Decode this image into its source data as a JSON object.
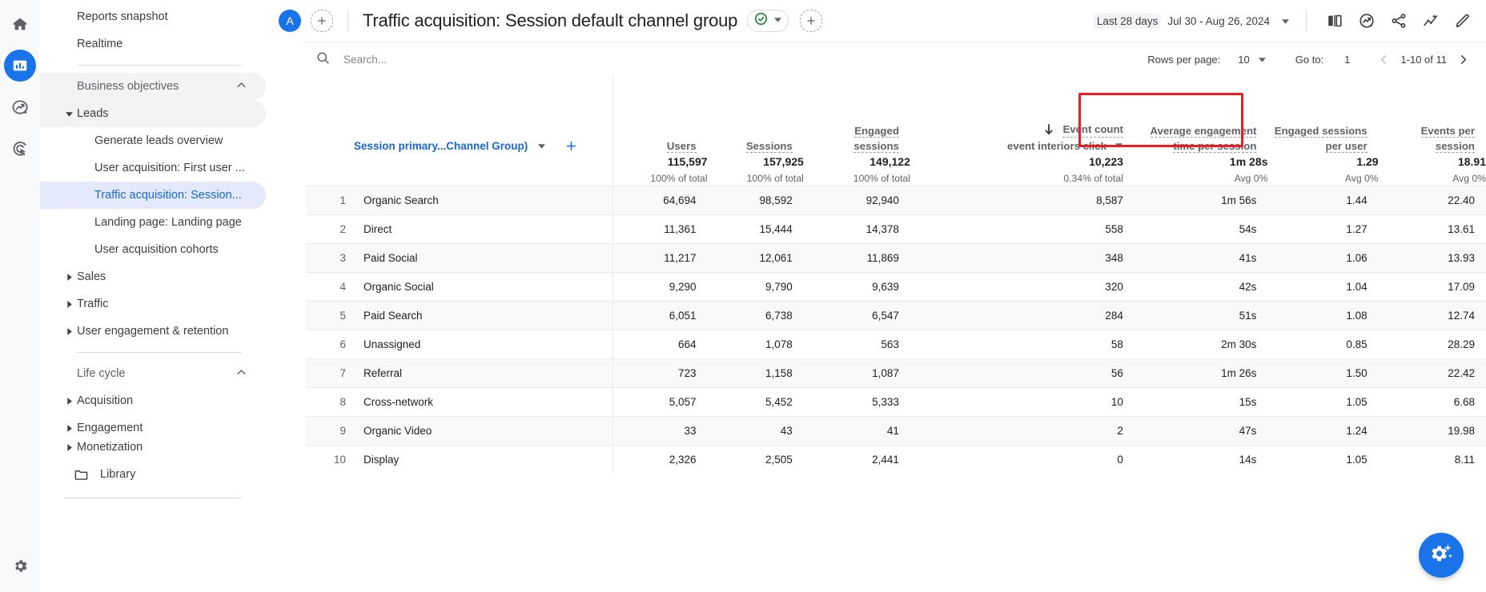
{
  "rail": {
    "items": [
      {
        "name": "home-icon",
        "label": "Home"
      },
      {
        "name": "reports-icon",
        "label": "Reports"
      },
      {
        "name": "explore-icon",
        "label": "Explore"
      },
      {
        "name": "advertising-icon",
        "label": "Advertising"
      }
    ],
    "settings_label": "Admin",
    "active_accent": "#1a73e8"
  },
  "sidebar": {
    "top_items": [
      {
        "label": "Reports snapshot"
      },
      {
        "label": "Realtime"
      }
    ],
    "sections": [
      {
        "label": "Business objectives",
        "expanded": true,
        "groups": [
          {
            "label": "Leads",
            "expanded": true,
            "highlighted": true,
            "children": [
              {
                "label": "Generate leads overview",
                "selected": false
              },
              {
                "label": "User acquisition: First user ...",
                "selected": false
              },
              {
                "label": "Traffic acquisition: Session...",
                "selected": true
              },
              {
                "label": "Landing page: Landing page",
                "selected": false
              },
              {
                "label": "User acquisition cohorts",
                "selected": false
              }
            ]
          },
          {
            "label": "Sales",
            "expanded": false,
            "children": []
          },
          {
            "label": "Traffic",
            "expanded": false,
            "children": []
          },
          {
            "label": "User engagement & retention",
            "expanded": false,
            "children": []
          }
        ]
      },
      {
        "label": "Life cycle",
        "expanded": true,
        "groups": [
          {
            "label": "Acquisition",
            "expanded": false,
            "children": []
          },
          {
            "label": "Engagement",
            "expanded": false,
            "children": []
          },
          {
            "label": "Monetization",
            "expanded": false,
            "children": []
          }
        ]
      }
    ],
    "library_label": "Library"
  },
  "header": {
    "account_initial": "A",
    "add_comparison_label": "+",
    "title": "Traffic acquisition: Session default channel group",
    "badge_icon": "check-circle-icon",
    "badge_color": "#188038",
    "add_tab_label": "+",
    "date_preset": "Last 28 days",
    "date_range": "Jul 30 - Aug 26, 2024",
    "icons": [
      {
        "name": "compare-icon"
      },
      {
        "name": "insights-icon"
      },
      {
        "name": "share-icon"
      },
      {
        "name": "explore-icon"
      },
      {
        "name": "edit-icon"
      }
    ]
  },
  "toolbar": {
    "search_placeholder": "Search...",
    "search_value": "",
    "rows_per_page_label": "Rows per page:",
    "rows_per_page_value": "10",
    "goto_label": "Go to:",
    "goto_value": "1",
    "range_label": "1-10 of 11"
  },
  "table": {
    "dimension_label": "Session primary...Channel Group)",
    "add_dimension_label": "+",
    "sorted_column_index": 3,
    "sort_direction": "desc",
    "highlight_color": "#ea1c24",
    "columns": [
      {
        "label": "Users",
        "sub": null
      },
      {
        "label": "Sessions",
        "sub": null
      },
      {
        "label": "Engaged sessions",
        "sub": null
      },
      {
        "label": "Event count",
        "sub": "event interiors click"
      },
      {
        "label": "Average engagement time per session",
        "sub": null
      },
      {
        "label": "Engaged sessions per user",
        "sub": null
      },
      {
        "label": "Events per session",
        "sub": null
      }
    ],
    "totals": [
      {
        "value": "115,597",
        "sub": "100% of total"
      },
      {
        "value": "157,925",
        "sub": "100% of total"
      },
      {
        "value": "149,122",
        "sub": "100% of total"
      },
      {
        "value": "10,223",
        "sub": "0.34% of total"
      },
      {
        "value": "1m 28s",
        "sub": "Avg 0%"
      },
      {
        "value": "1.29",
        "sub": "Avg 0%"
      },
      {
        "value": "18.91",
        "sub": "Avg 0%"
      }
    ],
    "rows": [
      {
        "index": "1",
        "dimension": "Organic Search",
        "values": [
          "64,694",
          "98,592",
          "92,940",
          "8,587",
          "1m 56s",
          "1.44",
          "22.40"
        ]
      },
      {
        "index": "2",
        "dimension": "Direct",
        "values": [
          "11,361",
          "15,444",
          "14,378",
          "558",
          "54s",
          "1.27",
          "13.61"
        ]
      },
      {
        "index": "3",
        "dimension": "Paid Social",
        "values": [
          "11,217",
          "12,061",
          "11,869",
          "348",
          "41s",
          "1.06",
          "13.93"
        ]
      },
      {
        "index": "4",
        "dimension": "Organic Social",
        "values": [
          "9,290",
          "9,790",
          "9,639",
          "320",
          "42s",
          "1.04",
          "17.09"
        ]
      },
      {
        "index": "5",
        "dimension": "Paid Search",
        "values": [
          "6,051",
          "6,738",
          "6,547",
          "284",
          "51s",
          "1.08",
          "12.74"
        ]
      },
      {
        "index": "6",
        "dimension": "Unassigned",
        "values": [
          "664",
          "1,078",
          "563",
          "58",
          "2m 30s",
          "0.85",
          "28.29"
        ]
      },
      {
        "index": "7",
        "dimension": "Referral",
        "values": [
          "723",
          "1,158",
          "1,087",
          "56",
          "1m 26s",
          "1.50",
          "22.42"
        ]
      },
      {
        "index": "8",
        "dimension": "Cross-network",
        "values": [
          "5,057",
          "5,452",
          "5,333",
          "10",
          "15s",
          "1.05",
          "6.68"
        ]
      },
      {
        "index": "9",
        "dimension": "Organic Video",
        "values": [
          "33",
          "43",
          "41",
          "2",
          "47s",
          "1.24",
          "19.98"
        ]
      },
      {
        "index": "10",
        "dimension": "Display",
        "values": [
          "2,326",
          "2,505",
          "2,441",
          "0",
          "14s",
          "1.05",
          "8.11"
        ]
      }
    ]
  },
  "fab": {
    "icon": "gear-sparkle-icon",
    "color": "#1a73e8"
  }
}
